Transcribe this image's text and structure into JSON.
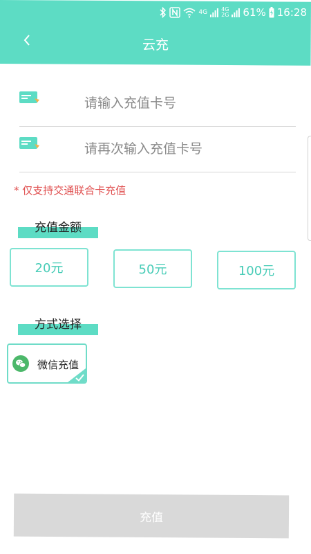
{
  "status_bar": {
    "network_top": "4G",
    "network_small_top": "4G",
    "network_small_bottom": "2G",
    "battery": "61%",
    "time": "16:28"
  },
  "header": {
    "title": "云充",
    "back_icon": "chevron-left-icon"
  },
  "form": {
    "card_number_placeholder": "请输入充值卡号",
    "card_number_value": "",
    "confirm_card_number_placeholder": "请再次输入充值卡号",
    "confirm_card_number_value": "",
    "notice": "* 仅支持交通联合卡充值"
  },
  "amount_section": {
    "title": "充值金额",
    "options": [
      "20元",
      "50元",
      "100元"
    ]
  },
  "method_section": {
    "title": "方式选择",
    "options": [
      {
        "label": "微信充值",
        "icon": "wechat-icon",
        "selected": true
      }
    ]
  },
  "submit": {
    "label": "充值"
  },
  "colors": {
    "accent": "#5ddcc4",
    "notice": "#e05050",
    "button_disabled": "#d9d9d9"
  }
}
